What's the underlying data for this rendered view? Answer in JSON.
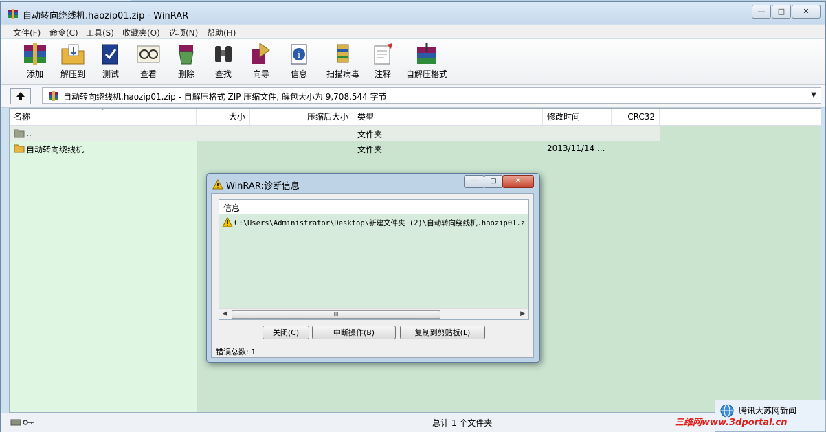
{
  "window": {
    "title": "自动转向绕线机.haozip01.zip - WinRAR"
  },
  "menu": [
    "文件(F)",
    "命令(C)",
    "工具(S)",
    "收藏夹(O)",
    "选项(N)",
    "帮助(H)"
  ],
  "toolbar": [
    "添加",
    "解压到",
    "测试",
    "查看",
    "删除",
    "查找",
    "向导",
    "信息",
    "扫描病毒",
    "注释",
    "自解压格式"
  ],
  "address": {
    "path": "自动转向绕线机.haozip01.zip - 自解压格式 ZIP 压缩文件, 解包大小为 9,708,544 字节"
  },
  "columns": [
    "名称",
    "大小",
    "压缩后大小",
    "类型",
    "修改时间",
    "CRC32"
  ],
  "rows": [
    {
      "name": "..",
      "type": "文件夹",
      "modified": ""
    },
    {
      "name": "自动转向绕线机",
      "type": "文件夹",
      "modified": "2013/11/14 ..."
    }
  ],
  "status": {
    "text": "总计 1 个文件夹"
  },
  "dialog": {
    "title": "WinRAR:诊断信息",
    "column": "信息",
    "message": "C:\\Users\\Administrator\\Desktop\\新建文件夹 (2)\\自动转向绕线机.haozip01.z",
    "scroll_glyph": "III",
    "buttons": [
      "关闭(C)",
      "中断操作(B)",
      "复制到剪贴板(L)"
    ],
    "error_count": "错误总数: 1"
  },
  "notification": {
    "text": "腾讯大苏网新闻"
  },
  "watermark": "三维网www.3dportal.cn",
  "colors": {
    "accent": "#cfe0ef",
    "list_bg": "#cae4d0",
    "warning": "#f2c200"
  }
}
